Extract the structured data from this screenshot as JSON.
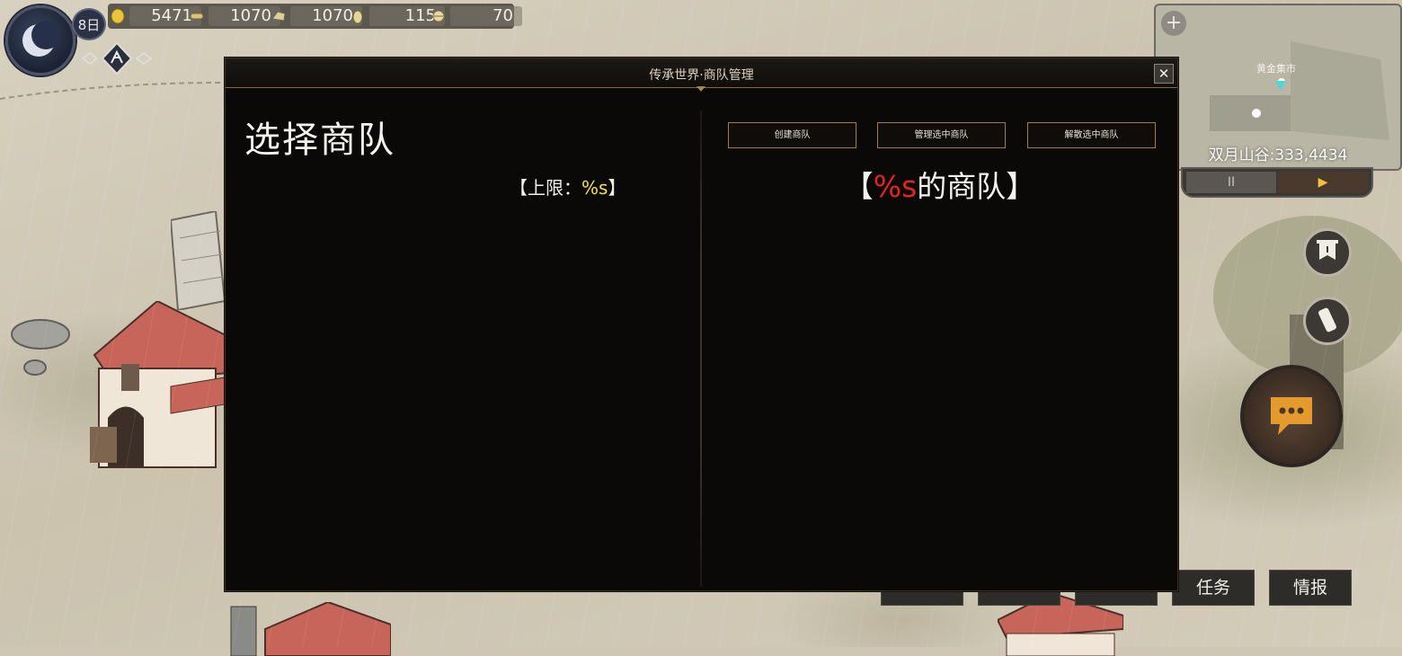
{
  "hud": {
    "day": "8日",
    "resources": [
      {
        "icon": "coin-icon",
        "value": "5471"
      },
      {
        "icon": "wood-icon",
        "value": "1070"
      },
      {
        "icon": "stone-icon",
        "value": "1070"
      },
      {
        "icon": "grain-icon",
        "value": "115"
      },
      {
        "icon": "cloth-icon",
        "value": "70"
      }
    ]
  },
  "minimap": {
    "zoom_label": "+",
    "place_label": "黄金集市",
    "coord_text": "双月山谷:333,4434",
    "pause_label": "II",
    "play_label": "▶"
  },
  "bottom_tabs": {
    "quest": "任务",
    "intel": "情报"
  },
  "modal": {
    "title": "传承世界·商队管理",
    "close_label": "✕",
    "left_title": "选择商队",
    "limit_open": "【上限：",
    "limit_value": "%s",
    "limit_close": "】",
    "buttons": {
      "create": "创建商队",
      "manage": "管理选中商队",
      "disband": "解散选中商队"
    },
    "caravan_open": "【",
    "caravan_placeholder": "%s",
    "caravan_rest": "的商队】"
  },
  "colors": {
    "modal_bg": "#0b0908",
    "accent_gold": "#9e7f45",
    "limit_value": "#f5e347",
    "placeholder_red": "#e32521"
  }
}
